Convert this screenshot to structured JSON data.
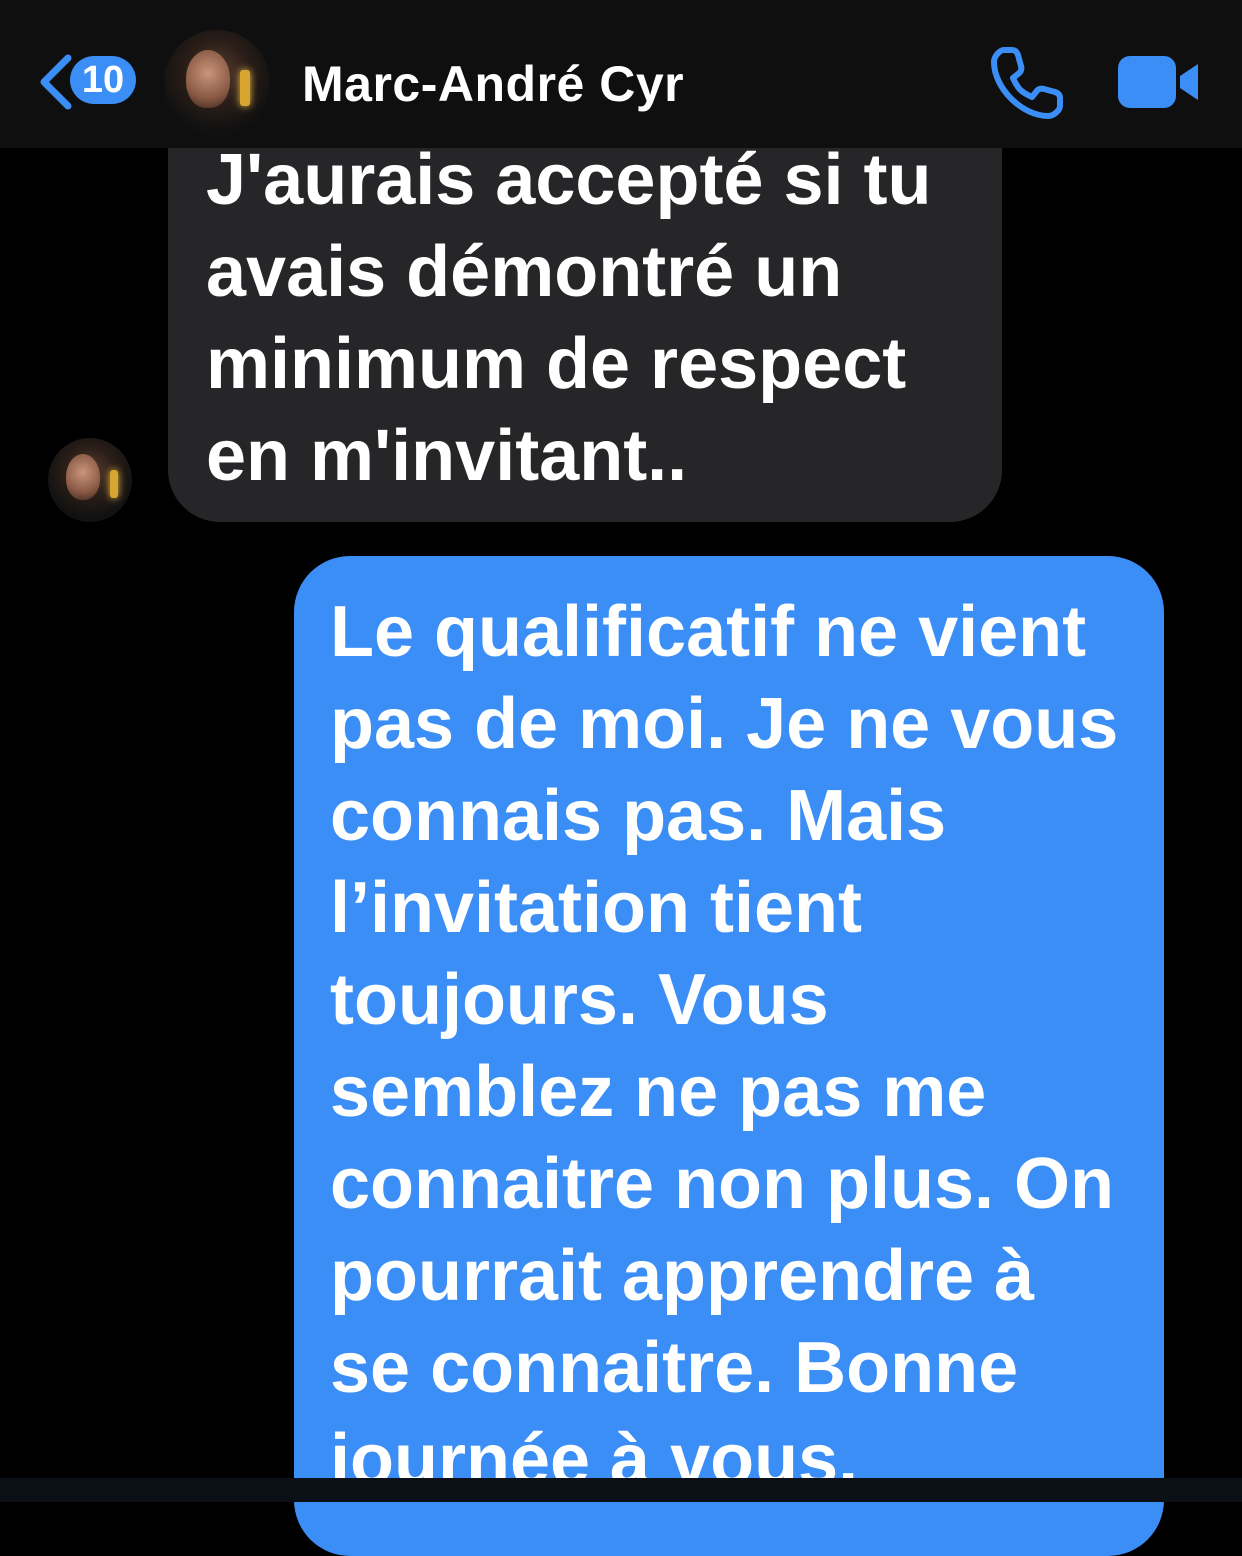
{
  "header": {
    "back_count": "10",
    "contact_name": "Marc-André Cyr",
    "call_icon": "phone-icon",
    "video_icon": "video-camera-icon"
  },
  "messages": [
    {
      "direction": "incoming",
      "text": "J'aurais accepté si tu\navais démontré un\nminimum de respect\nen m'invitant.."
    },
    {
      "direction": "outgoing",
      "text": "Le qualificatif ne vient\npas de moi. Je ne vous\nconnais pas. Mais\nl’invitation tient\ntoujours. Vous\nsemblez ne pas me\nconnaitre non plus. On\npourrait apprendre à\nse connaitre.  Bonne\njournée à vous."
    }
  ],
  "colors": {
    "accent": "#3b8ef5",
    "incoming_bubble": "#262628",
    "background": "#000000",
    "header": "#0f0f10"
  }
}
